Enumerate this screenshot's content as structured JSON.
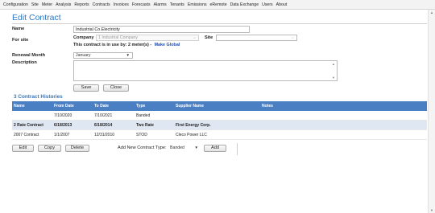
{
  "menu": [
    "Configuration",
    "Site",
    "Meter",
    "Analysis",
    "Reports",
    "Contracts",
    "Invoices",
    "Forecasts",
    "Alarms",
    "Tenants",
    "Emissions",
    "eRemote",
    "Data Exchange",
    "Users",
    "About"
  ],
  "page": {
    "title": "Edit Contract"
  },
  "form": {
    "name_label": "Name",
    "name_value": "Industrial Co.Electricity",
    "for_site_label": "For site",
    "company_label": "Company",
    "company_value": "1 Industrial Company",
    "site_label": "Site",
    "site_value": "",
    "in_use_text": "This contract is in use by: 2 meter(s) -",
    "make_global_link": "Make Global",
    "renewal_label": "Renewal Month",
    "renewal_value": "January",
    "description_label": "Description",
    "description_value": "",
    "save_label": "Save",
    "close_label": "Close"
  },
  "histories": {
    "title": "3 Contract Histories",
    "columns": [
      "Name",
      "From Date",
      "To Date",
      "Type",
      "Supplier Name",
      "Notes"
    ],
    "rows": [
      {
        "name": "",
        "from": "7/10/2020",
        "to": "7/10/2021",
        "type": "Banded",
        "supplier": "",
        "notes": ""
      },
      {
        "name": "2 Rate Contract",
        "from": "6/18/2013",
        "to": "6/18/2014",
        "type": "Two Rate",
        "supplier": "First Energy Corp.",
        "notes": ""
      },
      {
        "name": "2007 Contract",
        "from": "1/1/2007",
        "to": "12/31/2010",
        "type": "STOD",
        "supplier": "Cleco Power LLC",
        "notes": ""
      }
    ]
  },
  "actions": {
    "edit_label": "Edit",
    "copy_label": "Copy",
    "delete_label": "Delete",
    "add_new_label": "Add New Contract Type:",
    "add_new_type": "Banded",
    "add_label": "Add"
  },
  "colors": {
    "accent": "#2f79c4",
    "table_header": "#4a7fc4",
    "alt_row": "#dfe7f3",
    "link": "#1f4fb0"
  }
}
